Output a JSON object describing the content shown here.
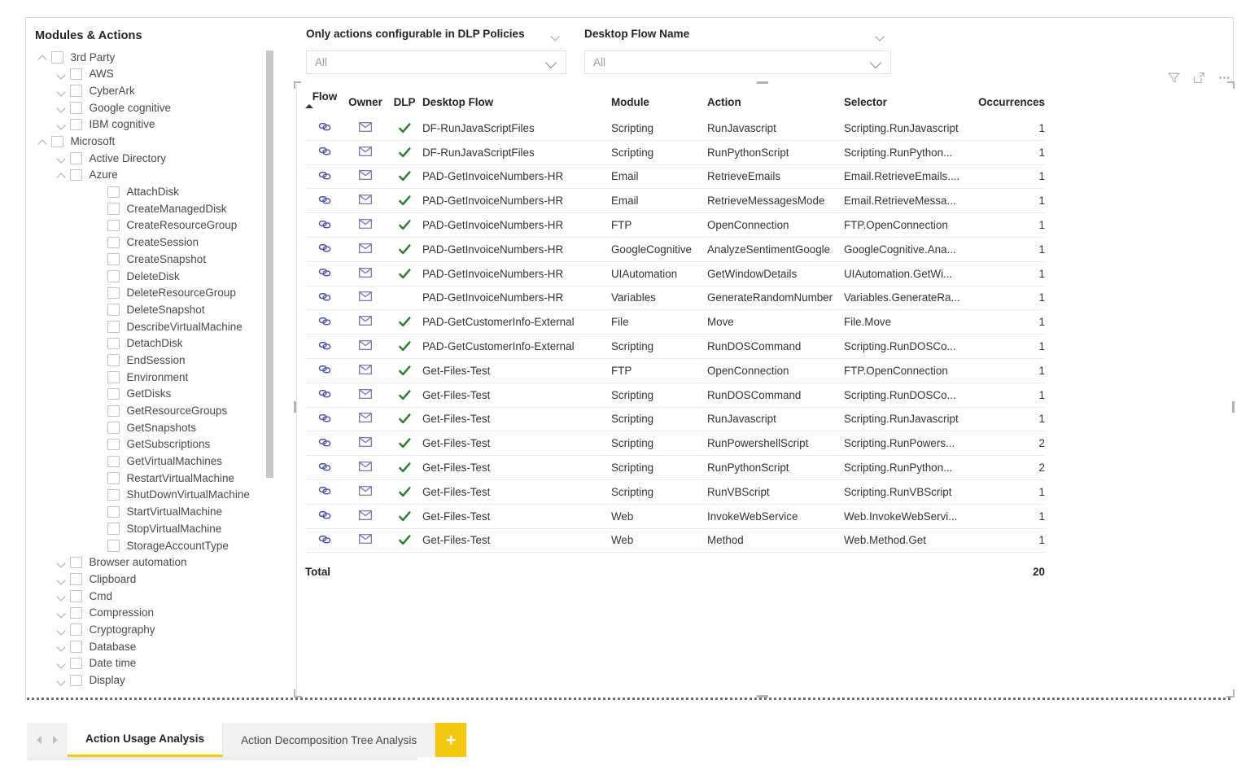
{
  "tree": {
    "title": "Modules & Actions",
    "nodes": [
      {
        "label": "3rd Party",
        "level": 0,
        "chevron": "up"
      },
      {
        "label": "AWS",
        "level": 1,
        "chevron": "down"
      },
      {
        "label": "CyberArk",
        "level": 1,
        "chevron": "down"
      },
      {
        "label": "Google cognitive",
        "level": 1,
        "chevron": "down"
      },
      {
        "label": "IBM cognitive",
        "level": 1,
        "chevron": "down"
      },
      {
        "label": "Microsoft",
        "level": 0,
        "chevron": "up"
      },
      {
        "label": "Active Directory",
        "level": 1,
        "chevron": "down"
      },
      {
        "label": "Azure",
        "level": 1,
        "chevron": "up"
      },
      {
        "label": "AttachDisk",
        "level": 2,
        "chevron": "none"
      },
      {
        "label": "CreateManagedDisk",
        "level": 2,
        "chevron": "none"
      },
      {
        "label": "CreateResourceGroup",
        "level": 2,
        "chevron": "none"
      },
      {
        "label": "CreateSession",
        "level": 2,
        "chevron": "none"
      },
      {
        "label": "CreateSnapshot",
        "level": 2,
        "chevron": "none"
      },
      {
        "label": "DeleteDisk",
        "level": 2,
        "chevron": "none"
      },
      {
        "label": "DeleteResourceGroup",
        "level": 2,
        "chevron": "none"
      },
      {
        "label": "DeleteSnapshot",
        "level": 2,
        "chevron": "none"
      },
      {
        "label": "DescribeVirtualMachine",
        "level": 2,
        "chevron": "none"
      },
      {
        "label": "DetachDisk",
        "level": 2,
        "chevron": "none"
      },
      {
        "label": "EndSession",
        "level": 2,
        "chevron": "none"
      },
      {
        "label": "Environment",
        "level": 2,
        "chevron": "none"
      },
      {
        "label": "GetDisks",
        "level": 2,
        "chevron": "none"
      },
      {
        "label": "GetResourceGroups",
        "level": 2,
        "chevron": "none"
      },
      {
        "label": "GetSnapshots",
        "level": 2,
        "chevron": "none"
      },
      {
        "label": "GetSubscriptions",
        "level": 2,
        "chevron": "none"
      },
      {
        "label": "GetVirtualMachines",
        "level": 2,
        "chevron": "none"
      },
      {
        "label": "RestartVirtualMachine",
        "level": 2,
        "chevron": "none"
      },
      {
        "label": "ShutDownVirtualMachine",
        "level": 2,
        "chevron": "none"
      },
      {
        "label": "StartVirtualMachine",
        "level": 2,
        "chevron": "none"
      },
      {
        "label": "StopVirtualMachine",
        "level": 2,
        "chevron": "none"
      },
      {
        "label": "StorageAccountType",
        "level": 2,
        "chevron": "none"
      },
      {
        "label": "Browser automation",
        "level": 1,
        "chevron": "down"
      },
      {
        "label": "Clipboard",
        "level": 1,
        "chevron": "down"
      },
      {
        "label": "Cmd",
        "level": 1,
        "chevron": "down"
      },
      {
        "label": "Compression",
        "level": 1,
        "chevron": "down"
      },
      {
        "label": "Cryptography",
        "level": 1,
        "chevron": "down"
      },
      {
        "label": "Database",
        "level": 1,
        "chevron": "down"
      },
      {
        "label": "Date time",
        "level": 1,
        "chevron": "down"
      },
      {
        "label": "Display",
        "level": 1,
        "chevron": "down"
      }
    ]
  },
  "slicers": [
    {
      "title": "Only actions configurable in DLP Policies",
      "value": "All"
    },
    {
      "title": "Desktop Flow Name",
      "value": "All"
    }
  ],
  "visual_toolbar": {
    "filter_icon": "filter-icon",
    "focus_icon": "focus-mode-icon",
    "more_icon": "more-options-icon"
  },
  "table": {
    "sort_column": "Flow",
    "sort_direction": "asc",
    "columns": [
      "Flow",
      "Owner",
      "DLP",
      "Desktop Flow",
      "Module",
      "Action",
      "Selector",
      "Occurrences"
    ],
    "rows": [
      {
        "flow": "flow-link-icon",
        "owner": "email-icon",
        "dlp": true,
        "desktop_flow": "DF-RunJavaScriptFiles",
        "module": "Scripting",
        "action": "RunJavascript",
        "selector": "Scripting.RunJavascript",
        "occurrences": "1"
      },
      {
        "flow": "flow-link-icon",
        "owner": "email-icon",
        "dlp": true,
        "desktop_flow": "DF-RunJavaScriptFiles",
        "module": "Scripting",
        "action": "RunPythonScript",
        "selector": "Scripting.RunPython...",
        "occurrences": "1"
      },
      {
        "flow": "flow-link-icon",
        "owner": "email-icon",
        "dlp": true,
        "desktop_flow": "PAD-GetInvoiceNumbers-HR",
        "module": "Email",
        "action": "RetrieveEmails",
        "selector": "Email.RetrieveEmails....",
        "occurrences": "1"
      },
      {
        "flow": "flow-link-icon",
        "owner": "email-icon",
        "dlp": true,
        "desktop_flow": "PAD-GetInvoiceNumbers-HR",
        "module": "Email",
        "action": "RetrieveMessagesMode",
        "selector": "Email.RetrieveMessa...",
        "occurrences": "1"
      },
      {
        "flow": "flow-link-icon",
        "owner": "email-icon",
        "dlp": true,
        "desktop_flow": "PAD-GetInvoiceNumbers-HR",
        "module": "FTP",
        "action": "OpenConnection",
        "selector": "FTP.OpenConnection",
        "occurrences": "1"
      },
      {
        "flow": "flow-link-icon",
        "owner": "email-icon",
        "dlp": true,
        "desktop_flow": "PAD-GetInvoiceNumbers-HR",
        "module": "GoogleCognitive",
        "action": "AnalyzeSentimentGoogle",
        "selector": "GoogleCognitive.Ana...",
        "occurrences": "1"
      },
      {
        "flow": "flow-link-icon",
        "owner": "email-icon",
        "dlp": true,
        "desktop_flow": "PAD-GetInvoiceNumbers-HR",
        "module": "UIAutomation",
        "action": "GetWindowDetails",
        "selector": "UIAutomation.GetWi...",
        "occurrences": "1"
      },
      {
        "flow": "flow-link-icon",
        "owner": "email-icon",
        "dlp": false,
        "desktop_flow": "PAD-GetInvoiceNumbers-HR",
        "module": "Variables",
        "action": "GenerateRandomNumber",
        "selector": "Variables.GenerateRa...",
        "occurrences": "1"
      },
      {
        "flow": "flow-link-icon",
        "owner": "email-icon",
        "dlp": true,
        "desktop_flow": "PAD-GetCustomerInfo-External",
        "module": "File",
        "action": "Move",
        "selector": "File.Move",
        "occurrences": "1"
      },
      {
        "flow": "flow-link-icon",
        "owner": "email-icon",
        "dlp": true,
        "desktop_flow": "PAD-GetCustomerInfo-External",
        "module": "Scripting",
        "action": "RunDOSCommand",
        "selector": "Scripting.RunDOSCo...",
        "occurrences": "1"
      },
      {
        "flow": "flow-link-icon",
        "owner": "email-icon",
        "dlp": true,
        "desktop_flow": "Get-Files-Test",
        "module": "FTP",
        "action": "OpenConnection",
        "selector": "FTP.OpenConnection",
        "occurrences": "1"
      },
      {
        "flow": "flow-link-icon",
        "owner": "email-icon",
        "dlp": true,
        "desktop_flow": "Get-Files-Test",
        "module": "Scripting",
        "action": "RunDOSCommand",
        "selector": "Scripting.RunDOSCo...",
        "occurrences": "1"
      },
      {
        "flow": "flow-link-icon",
        "owner": "email-icon",
        "dlp": true,
        "desktop_flow": "Get-Files-Test",
        "module": "Scripting",
        "action": "RunJavascript",
        "selector": "Scripting.RunJavascript",
        "occurrences": "1"
      },
      {
        "flow": "flow-link-icon",
        "owner": "email-icon",
        "dlp": true,
        "desktop_flow": "Get-Files-Test",
        "module": "Scripting",
        "action": "RunPowershellScript",
        "selector": "Scripting.RunPowers...",
        "occurrences": "2"
      },
      {
        "flow": "flow-link-icon",
        "owner": "email-icon",
        "dlp": true,
        "desktop_flow": "Get-Files-Test",
        "module": "Scripting",
        "action": "RunPythonScript",
        "selector": "Scripting.RunPython...",
        "occurrences": "2"
      },
      {
        "flow": "flow-link-icon",
        "owner": "email-icon",
        "dlp": true,
        "desktop_flow": "Get-Files-Test",
        "module": "Scripting",
        "action": "RunVBScript",
        "selector": "Scripting.RunVBScript",
        "occurrences": "1"
      },
      {
        "flow": "flow-link-icon",
        "owner": "email-icon",
        "dlp": true,
        "desktop_flow": "Get-Files-Test",
        "module": "Web",
        "action": "InvokeWebService",
        "selector": "Web.InvokeWebServi...",
        "occurrences": "1"
      },
      {
        "flow": "flow-link-icon",
        "owner": "email-icon",
        "dlp": true,
        "desktop_flow": "Get-Files-Test",
        "module": "Web",
        "action": "Method",
        "selector": "Web.Method.Get",
        "occurrences": "1"
      }
    ],
    "total_label": "Total",
    "total_occurrences": "20"
  },
  "tabbar": {
    "tabs": [
      {
        "label": "Action Usage Analysis",
        "active": true
      },
      {
        "label": "Action Decomposition Tree Analysis",
        "active": false
      }
    ],
    "add_label": "+"
  },
  "colors": {
    "accent_yellow": "#f2c811",
    "dlp_green": "#2f7d32",
    "flow_icon": "#4a52a8",
    "owner_icon": "#7a6ab0"
  }
}
